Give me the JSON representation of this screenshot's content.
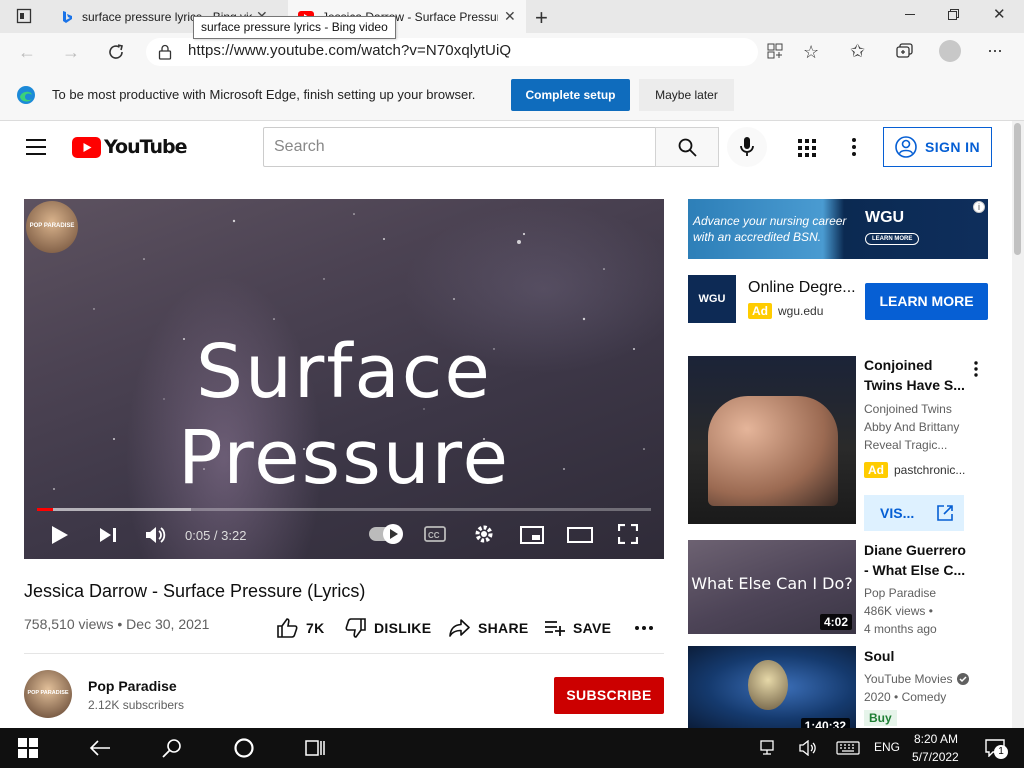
{
  "browser": {
    "tabs": [
      {
        "title": "surface pressure lyrics - Bing video",
        "active": false,
        "icon": "bing-icon"
      },
      {
        "title": "Jessica Darrow - Surface Pressure (Lyrics) - YouTube",
        "active": true,
        "icon": "youtube-icon"
      }
    ],
    "tooltip": "surface pressure lyrics - Bing video",
    "url": "https://www.youtube.com/watch?v=N70xqlytUiQ",
    "infobar": {
      "message": "To be most productive with Microsoft Edge, finish setting up your browser.",
      "primary_label": "Complete setup",
      "secondary_label": "Maybe later"
    }
  },
  "youtube": {
    "logo_text": "YouTube",
    "search_placeholder": "Search",
    "signin_label": "SIGN IN"
  },
  "player": {
    "overlay_title": "Surface Pressure",
    "watermark": "POP PARADISE",
    "time": "0:05 / 3:22",
    "progress_fraction": 0.026,
    "buffered_fraction": 0.25
  },
  "video": {
    "title": "Jessica Darrow - Surface Pressure (Lyrics)",
    "views_date": "758,510 views • Dec 30, 2021",
    "like_count": "7K",
    "dislike_label": "DISLIKE",
    "share_label": "SHARE",
    "save_label": "SAVE"
  },
  "channel": {
    "name": "Pop Paradise",
    "subscribers": "2.12K subscribers",
    "subscribe_label": "SUBSCRIBE",
    "avatar_text": "POP PARADISE"
  },
  "sidebar": {
    "banner_text": "Advance your nursing career with an accredited BSN.",
    "banner_brand": "WGU",
    "banner_cta": "LEARN MORE",
    "ad": {
      "logo": "WGU",
      "title": "Online Degre...",
      "badge": "Ad",
      "domain": "wgu.edu",
      "cta": "LEARN MORE"
    },
    "recs": [
      {
        "title_lines": [
          "Conjoined",
          "Twins Have S..."
        ],
        "meta_lines": [
          "Conjoined Twins",
          "Abby And Brittany",
          "Reveal Tragic..."
        ],
        "badge": "Ad",
        "domain": "pastchronic...",
        "visit_label": "VIS..."
      },
      {
        "title_lines": [
          "Diane Guerrero",
          "- What Else C..."
        ],
        "thumb_text": "What Else Can I Do?",
        "duration": "4:02",
        "meta_lines": [
          "Pop Paradise",
          "486K views •",
          "4 months ago"
        ]
      },
      {
        "title_lines": [
          "Soul"
        ],
        "duration": "1:40:32",
        "meta_lines": [
          "YouTube Movies",
          "2020 • Comedy"
        ],
        "buy_label": "Buy"
      }
    ]
  },
  "taskbar": {
    "lang": "ENG",
    "time": "8:20 AM",
    "date": "5/7/2022",
    "notification_count": "1"
  },
  "colors": {
    "youtube_red": "#ff0000",
    "link_blue": "#065fd4",
    "subscribe_red": "#cc0000",
    "edge_blue": "#0f6cbd"
  }
}
